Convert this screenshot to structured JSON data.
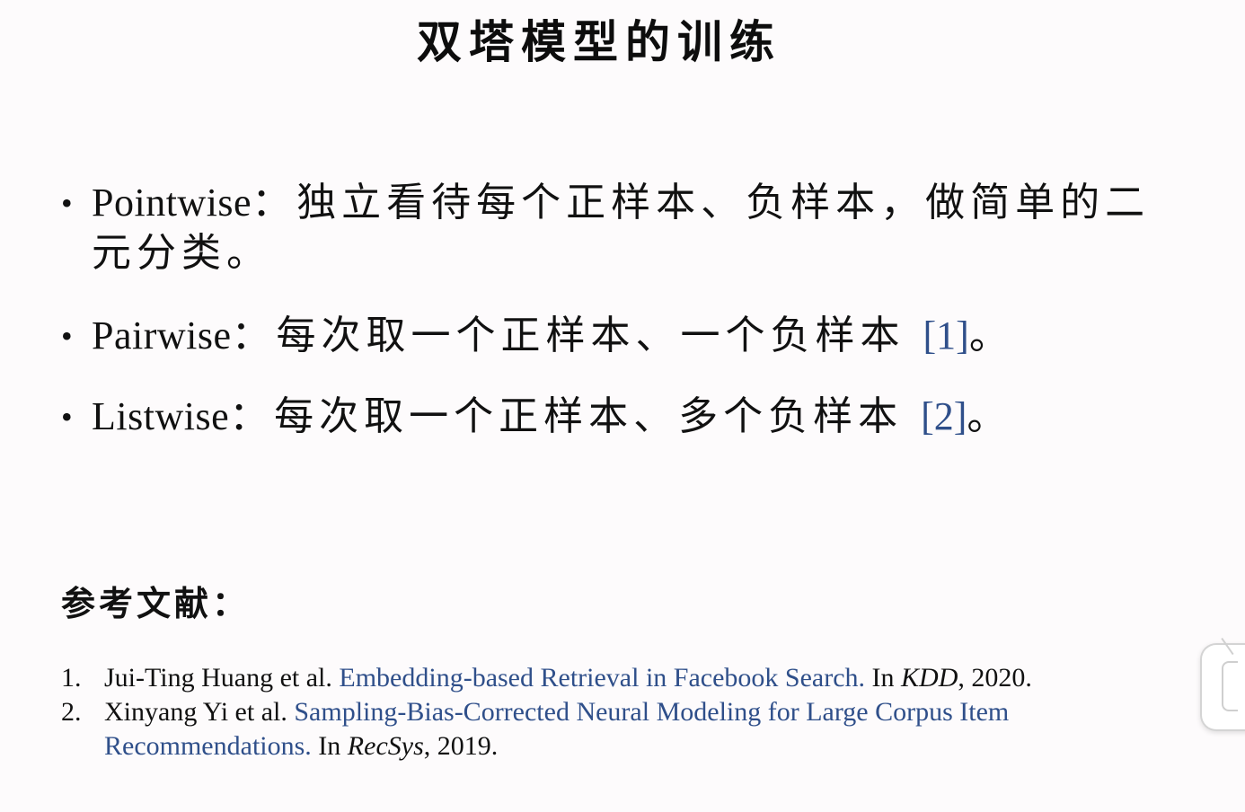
{
  "slide": {
    "title": "双塔模型的训练"
  },
  "bullets": [
    {
      "term": "Pointwise",
      "text": "：独立看待每个正样本、负样本，做简单的二元分类。",
      "citation": "",
      "tail": ""
    },
    {
      "term": "Pairwise",
      "text": "：每次取一个正样本、一个负样本 ",
      "citation": "[1]",
      "tail": "。"
    },
    {
      "term": "Listwise",
      "text": "：每次取一个正样本、多个负样本 ",
      "citation": "[2]",
      "tail": "。"
    }
  ],
  "references": {
    "heading": "参考文献：",
    "items": [
      {
        "number": "1.",
        "authors": "Jui-Ting Huang et al. ",
        "title": "Embedding-based Retrieval in Facebook Search.",
        "in": " In ",
        "venue": "KDD",
        "year": ", 2020."
      },
      {
        "number": "2.",
        "authors": "Xinyang Yi et al. ",
        "title": "Sampling-Bias-Corrected Neural Modeling for Large Corpus Item Recommendations.",
        "in": " In ",
        "venue": "RecSys",
        "year": ", 2019."
      }
    ]
  },
  "colors": {
    "link": "#2f4f8a",
    "text": "#111111",
    "background": "#fdfbfc"
  }
}
